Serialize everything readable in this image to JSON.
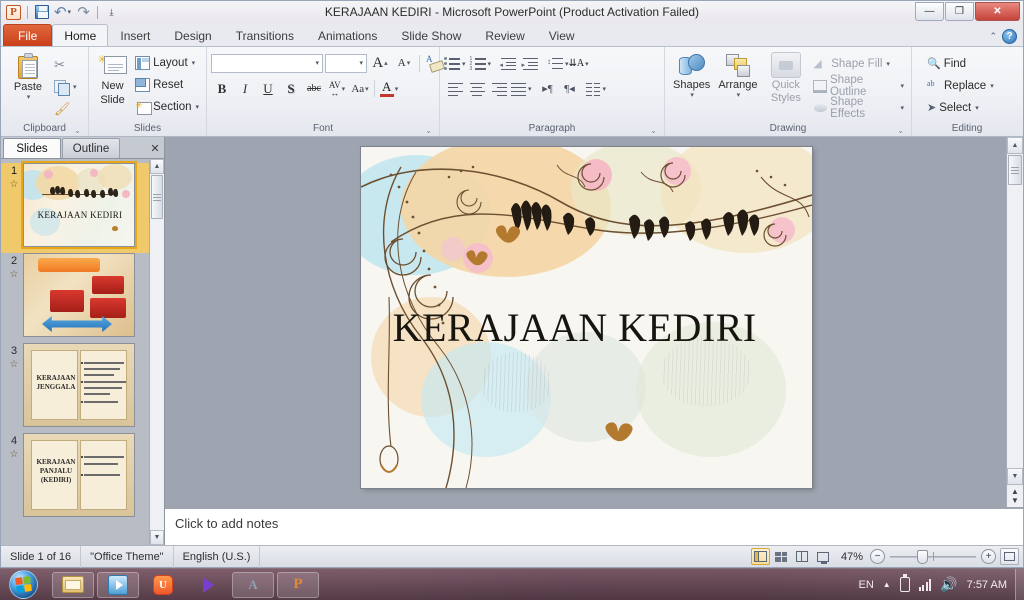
{
  "window": {
    "title": "KERAJAAN KEDIRI  -  Microsoft PowerPoint (Product Activation Failed)",
    "minimize_label": "—",
    "restore_label": "❐",
    "close_label": "✕"
  },
  "quick_access": {
    "app_icon_label": "P",
    "save_label": "Save",
    "undo_label": "Undo",
    "redo_label": "Redo",
    "customize_label": "Customize Quick Access Toolbar"
  },
  "ribbon": {
    "tabs": [
      {
        "label": "File",
        "active": false
      },
      {
        "label": "Home",
        "active": true
      },
      {
        "label": "Insert",
        "active": false
      },
      {
        "label": "Design",
        "active": false
      },
      {
        "label": "Transitions",
        "active": false
      },
      {
        "label": "Animations",
        "active": false
      },
      {
        "label": "Slide Show",
        "active": false
      },
      {
        "label": "Review",
        "active": false
      },
      {
        "label": "View",
        "active": false
      }
    ],
    "help_label": "?",
    "groups": {
      "clipboard": {
        "title": "Clipboard",
        "paste_label": "Paste",
        "cut_label": "Cut",
        "copy_label": "Copy",
        "format_painter_label": "Format Painter"
      },
      "slides": {
        "title": "Slides",
        "new_slide_line1": "New",
        "new_slide_line2": "Slide",
        "layout_label": "Layout",
        "reset_label": "Reset",
        "section_label": "Section"
      },
      "font": {
        "title": "Font",
        "font_name_value": "",
        "font_size_value": "",
        "bold_label": "B",
        "italic_label": "I",
        "underline_label": "U",
        "shadow_label": "S",
        "strikethrough_label": "abc",
        "spacing_label": "AV",
        "change_case_label": "Aa",
        "font_color_label": "A",
        "grow_font_label": "A",
        "shrink_font_label": "A",
        "clear_formatting_label": "Clear All Formatting"
      },
      "paragraph": {
        "title": "Paragraph",
        "bullets_label": "Bullets",
        "numbering_label": "Numbering",
        "decrease_indent_label": "Decrease List Level",
        "increase_indent_label": "Increase List Level",
        "line_spacing_label": "Line Spacing",
        "align_left_label": "Align Text Left",
        "center_label": "Center",
        "align_right_label": "Align Text Right",
        "justify_label": "Justify",
        "ltr_label": "Left-to-Right",
        "rtl_label": "Right-to-Left",
        "columns_label": "Columns",
        "text_direction_label": "Text Direction",
        "align_text_label": "Align Text",
        "smartart_label": "Convert to SmartArt"
      },
      "drawing": {
        "title": "Drawing",
        "shapes_label": "Shapes",
        "arrange_label": "Arrange",
        "quick_styles_line1": "Quick",
        "quick_styles_line2": "Styles",
        "shape_fill_label": "Shape Fill",
        "shape_outline_label": "Shape Outline",
        "shape_effects_label": "Shape Effects"
      },
      "editing": {
        "title": "Editing",
        "find_label": "Find",
        "replace_label": "Replace",
        "select_label": "Select"
      }
    }
  },
  "slides_panel": {
    "tabs": [
      {
        "label": "Slides",
        "active": true
      },
      {
        "label": "Outline",
        "active": false
      }
    ],
    "close_label": "✕",
    "thumbnails": [
      {
        "number": "1",
        "title": "KERAJAAN  KEDIRI",
        "selected": true
      },
      {
        "number": "2",
        "title": "",
        "selected": false
      },
      {
        "number": "3",
        "title": "KERAJAAN JENGGALA",
        "selected": false
      },
      {
        "number": "4",
        "title": "KERAJAAN PANJALU (KEDIRI)",
        "selected": false
      }
    ]
  },
  "slide": {
    "title": "KERAJAAN KEDIRI"
  },
  "notes": {
    "placeholder": "Click to add notes"
  },
  "status_bar": {
    "slide_counter": "Slide 1 of 16",
    "theme": "\"Office Theme\"",
    "language": "English (U.S.)",
    "zoom_level": "47%",
    "zoom_out_label": "−",
    "zoom_in_label": "+",
    "views": [
      {
        "name": "normal",
        "label": "Normal",
        "active": true
      },
      {
        "name": "slide-sorter",
        "label": "Slide Sorter",
        "active": false
      },
      {
        "name": "reading",
        "label": "Reading View",
        "active": false
      },
      {
        "name": "slideshow",
        "label": "Slide Show",
        "active": false
      }
    ],
    "fit_label": "Fit slide to current window"
  },
  "taskbar": {
    "start_label": "Start",
    "items": [
      {
        "name": "explorer",
        "label": "Windows Explorer"
      },
      {
        "name": "media-player",
        "label": "Windows Media Player"
      },
      {
        "name": "uc-browser",
        "label": "UC Browser"
      },
      {
        "name": "video-player",
        "label": "Video Player"
      },
      {
        "name": "app-window",
        "label": "Application"
      },
      {
        "name": "powerpoint-window",
        "label": "Microsoft PowerPoint"
      }
    ],
    "tray": {
      "language": "EN",
      "show_hidden_label": "▲",
      "battery_label": "Battery",
      "network_label": "Network",
      "volume_label": "Volume",
      "clock": "7:57 AM"
    }
  }
}
